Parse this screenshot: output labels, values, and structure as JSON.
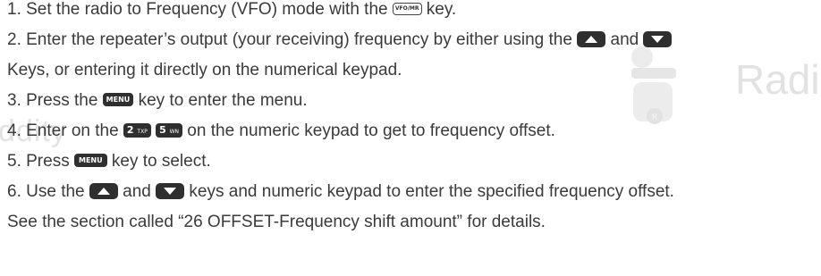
{
  "watermark": {
    "left_text": "ddity",
    "right_text": "Radi"
  },
  "keys": {
    "vfo_mr": "VFO/MR",
    "menu": "MENU",
    "num2": "2",
    "num2_sub": "TXP",
    "num5": "5",
    "num5_sub": "WN"
  },
  "steps": [
    {
      "a": "1. Set the radio to Frequency (VFO) mode with the ",
      "b": " key."
    },
    {
      "a": "2. Enter the repeater’s output (your receiving) frequency by either using the ",
      "b": " and "
    },
    {
      "a": "Keys, or entering it directly on the numerical keypad."
    },
    {
      "a": "3.  Press the ",
      "b": " key to enter the menu."
    },
    {
      "a": "4. Enter on the ",
      "b": " on the numeric keypad to get to frequency offset."
    },
    {
      "a": "5. Press ",
      "b": " key to select."
    },
    {
      "a": "6. Use the ",
      "b": " and ",
      "c": " keys and numeric keypad to enter the specified frequency offset."
    },
    {
      "a": "See the section called “26 OFFSET-Frequency shift amount” for details."
    }
  ],
  "icons": {
    "up_arrow": "up-arrow-key-icon",
    "down_arrow": "down-arrow-key-icon"
  }
}
